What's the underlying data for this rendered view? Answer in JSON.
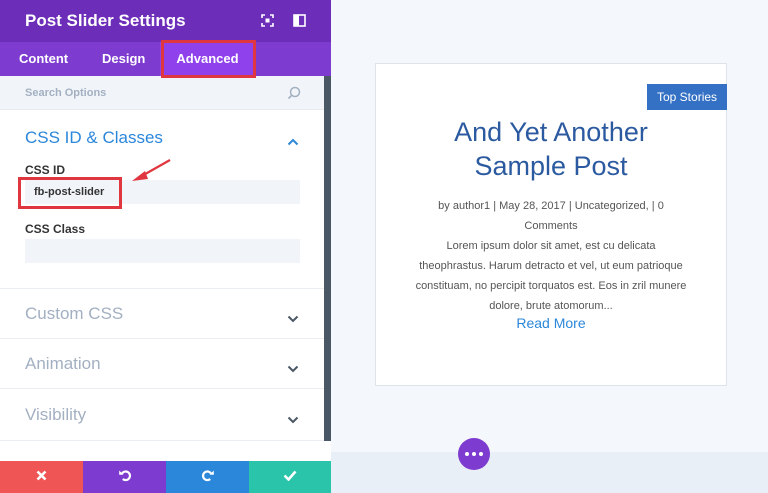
{
  "panel": {
    "title": "Post Slider Settings",
    "tabs": [
      {
        "label": "Content",
        "active": false
      },
      {
        "label": "Design",
        "active": false
      },
      {
        "label": "Advanced",
        "active": true
      }
    ],
    "search_placeholder": "Search Options",
    "sections": [
      {
        "title": "CSS ID & Classes",
        "expanded": true
      },
      {
        "title": "Custom CSS",
        "expanded": false
      },
      {
        "title": "Animation",
        "expanded": false
      },
      {
        "title": "Visibility",
        "expanded": false
      }
    ],
    "fields": {
      "css_id_label": "CSS ID",
      "css_id_value": "fb-post-slider",
      "css_class_label": "CSS Class",
      "css_class_value": ""
    },
    "footer_colors": [
      "#ef5555",
      "#7e3bd0",
      "#2b87da",
      "#29c4a9"
    ]
  },
  "preview": {
    "badge": "Top Stories",
    "title_line1": "And Yet Another",
    "title_line2": "Sample Post",
    "meta_line1": "by author1 | May 28, 2017 | Uncategorized, | 0",
    "meta_line2": "Comments",
    "excerpt": "Lorem ipsum dolor sit amet, est cu delicata theophrastus. Harum detracto et vel, ut eum patrioque constituam, no percipit torquatos est. Eos in zril munere dolore, brute atomorum...",
    "read_more": "Read More"
  },
  "colors": {
    "header": "#6c2eb9",
    "tabs": "#7e3bd0",
    "active_tab": "#8f42ec",
    "accent_blue": "#2b87da",
    "highlight_red": "#e0363f"
  }
}
